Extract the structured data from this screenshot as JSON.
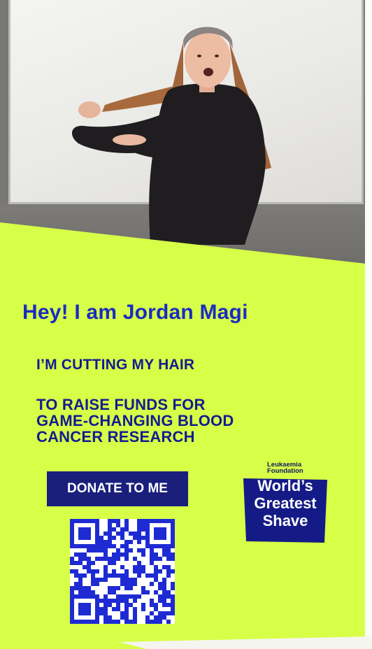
{
  "profile": {
    "greeting": "Hey! I am Jordan Magi"
  },
  "message": {
    "line1": "I’M CUTTING MY HAIR",
    "raise_lines": [
      "TO RAISE FUNDS FOR",
      "GAME-CHANGING BLOOD",
      "CANCER RESEARCH"
    ]
  },
  "donate": {
    "label": "DONATE TO ME"
  },
  "logo": {
    "org_lines": [
      "Leukaemia",
      "Foundation"
    ],
    "campaign_lines": [
      "World’s",
      "Greatest",
      "Shave"
    ]
  },
  "colors": {
    "background": "#d7ff48",
    "heading_blue": "#1b2cc1",
    "navy": "#141c8f",
    "button": "#1a1f7c",
    "qr": "#1e2bd3"
  },
  "icons": [
    "qr-code-icon",
    "world-greatest-shave-logo"
  ]
}
